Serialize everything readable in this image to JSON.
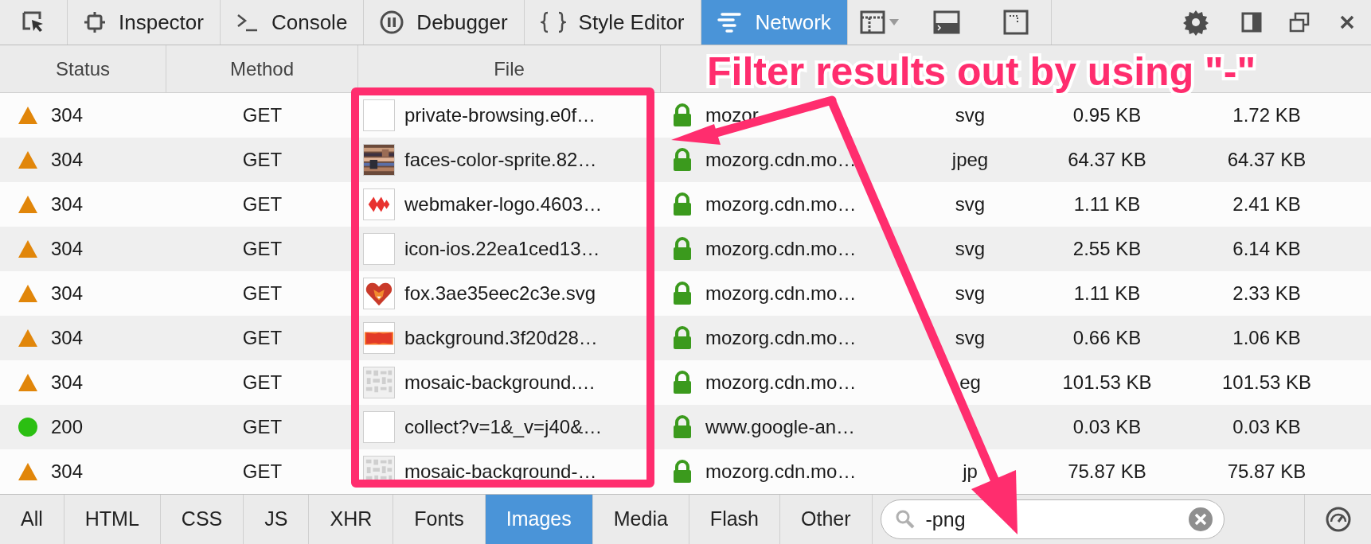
{
  "toolbar": {
    "tabs": [
      {
        "label": "Inspector",
        "selected": false
      },
      {
        "label": "Console",
        "selected": false
      },
      {
        "label": "Debugger",
        "selected": false
      },
      {
        "label": "Style Editor",
        "selected": false
      },
      {
        "label": "Network",
        "selected": true
      }
    ]
  },
  "table": {
    "columns": [
      "Status",
      "Method",
      "File"
    ],
    "rows": [
      {
        "kind": "warning",
        "status": "304",
        "method": "GET",
        "file": "private-browsing.e0f…",
        "domain": "mozor",
        "type": "svg",
        "transferred": "0.95 KB",
        "size": "1.72 KB"
      },
      {
        "kind": "warning",
        "status": "304",
        "method": "GET",
        "file": "faces-color-sprite.82…",
        "domain": "mozorg.cdn.mo…",
        "type": "jpeg",
        "transferred": "64.37 KB",
        "size": "64.37 KB"
      },
      {
        "kind": "warning",
        "status": "304",
        "method": "GET",
        "file": "webmaker-logo.4603…",
        "domain": "mozorg.cdn.mo…",
        "type": "svg",
        "transferred": "1.11 KB",
        "size": "2.41 KB"
      },
      {
        "kind": "warning",
        "status": "304",
        "method": "GET",
        "file": "icon-ios.22ea1ced13…",
        "domain": "mozorg.cdn.mo…",
        "type": "svg",
        "transferred": "2.55 KB",
        "size": "6.14 KB"
      },
      {
        "kind": "warning",
        "status": "304",
        "method": "GET",
        "file": "fox.3ae35eec2c3e.svg",
        "domain": "mozorg.cdn.mo…",
        "type": "svg",
        "transferred": "1.11 KB",
        "size": "2.33 KB"
      },
      {
        "kind": "warning",
        "status": "304",
        "method": "GET",
        "file": "background.3f20d28…",
        "domain": "mozorg.cdn.mo…",
        "type": "svg",
        "transferred": "0.66 KB",
        "size": "1.06 KB"
      },
      {
        "kind": "warning",
        "status": "304",
        "method": "GET",
        "file": "mosaic-background.…",
        "domain": "mozorg.cdn.mo…",
        "type": "eg",
        "transferred": "101.53 KB",
        "size": "101.53 KB"
      },
      {
        "kind": "success",
        "status": "200",
        "method": "GET",
        "file": "collect?v=1&_v=j40&…",
        "domain": "www.google-an…",
        "transferred": "0.03 KB",
        "size": "0.03 KB"
      },
      {
        "kind": "warning",
        "status": "304",
        "method": "GET",
        "file": "mosaic-background-…",
        "domain": "mozorg.cdn.mo…",
        "type": "jp",
        "transferred": "75.87 KB",
        "size": "75.87 KB"
      }
    ]
  },
  "filters": [
    {
      "label": "All",
      "selected": false
    },
    {
      "label": "HTML",
      "selected": false
    },
    {
      "label": "CSS",
      "selected": false
    },
    {
      "label": "JS",
      "selected": false
    },
    {
      "label": "XHR",
      "selected": false
    },
    {
      "label": "Fonts",
      "selected": false
    },
    {
      "label": "Images",
      "selected": true
    },
    {
      "label": "Media",
      "selected": false
    },
    {
      "label": "Flash",
      "selected": false
    },
    {
      "label": "Other",
      "selected": false
    }
  ],
  "search": {
    "value": "-png"
  },
  "annotation": {
    "text": "Filter results out by using \"-\""
  }
}
